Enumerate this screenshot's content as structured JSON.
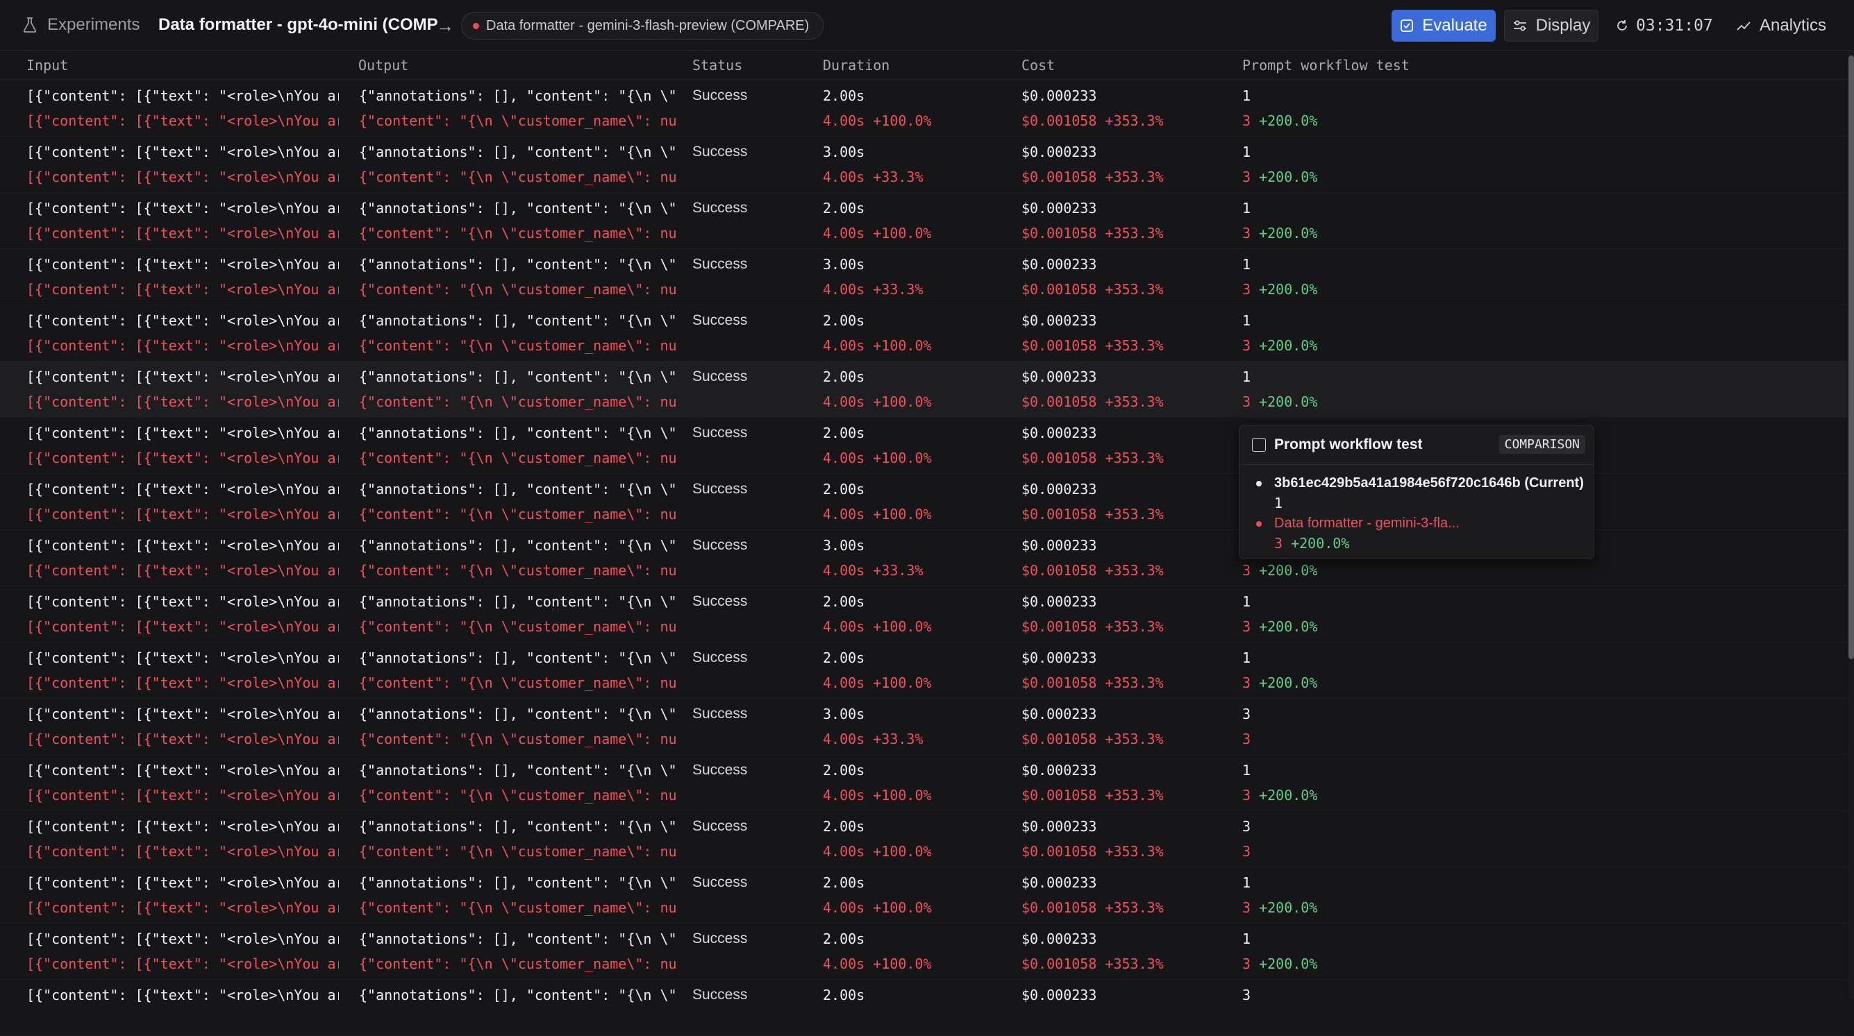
{
  "header": {
    "root_label": "Experiments",
    "title": "Data formatter - gpt-4o-mini (COMP",
    "compare_label": "Data formatter - gemini-3-flash-preview (COMPARE)",
    "evaluate_label": "Evaluate",
    "display_label": "Display",
    "timer": "03:31:07",
    "analytics_label": "Analytics"
  },
  "columns": [
    "Input",
    "Output",
    "Status",
    "Duration",
    "Cost",
    "Prompt workflow test"
  ],
  "rows": [
    {
      "input": "[{\"content\": [{\"text\": \"<role>\\nYou are a",
      "input_cmp": "[{\"content\": [{\"text\": \"<role>\\nYou are a",
      "output": "{\"annotations\": [], \"content\": \"{\\n \\\"cust",
      "output_cmp": "{\"content\": \"{\\n \\\"customer_name\\\": null,\\",
      "status": "Success",
      "duration": "2.00s",
      "duration_cmp": "4.00s +100.0%",
      "cost": "$0.000233",
      "cost_cmp": "$0.001058 +353.3%",
      "score": "1",
      "score_cmp": "3",
      "score_delta": "+200.0%"
    },
    {
      "input": "[{\"content\": [{\"text\": \"<role>\\nYou are a",
      "input_cmp": "[{\"content\": [{\"text\": \"<role>\\nYou are a",
      "output": "{\"annotations\": [], \"content\": \"{\\n \\\"cust",
      "output_cmp": "{\"content\": \"{\\n \\\"customer_name\\\": null,\\",
      "status": "Success",
      "duration": "3.00s",
      "duration_cmp": "4.00s +33.3%",
      "cost": "$0.000233",
      "cost_cmp": "$0.001058 +353.3%",
      "score": "1",
      "score_cmp": "3",
      "score_delta": "+200.0%"
    },
    {
      "input": "[{\"content\": [{\"text\": \"<role>\\nYou are a",
      "input_cmp": "[{\"content\": [{\"text\": \"<role>\\nYou are a",
      "output": "{\"annotations\": [], \"content\": \"{\\n \\\"cust",
      "output_cmp": "{\"content\": \"{\\n \\\"customer_name\\\": null,\\",
      "status": "Success",
      "duration": "2.00s",
      "duration_cmp": "4.00s +100.0%",
      "cost": "$0.000233",
      "cost_cmp": "$0.001058 +353.3%",
      "score": "1",
      "score_cmp": "3",
      "score_delta": "+200.0%"
    },
    {
      "input": "[{\"content\": [{\"text\": \"<role>\\nYou are a",
      "input_cmp": "[{\"content\": [{\"text\": \"<role>\\nYou are a",
      "output": "{\"annotations\": [], \"content\": \"{\\n \\\"cust",
      "output_cmp": "{\"content\": \"{\\n \\\"customer_name\\\": null,\\",
      "status": "Success",
      "duration": "3.00s",
      "duration_cmp": "4.00s +33.3%",
      "cost": "$0.000233",
      "cost_cmp": "$0.001058 +353.3%",
      "score": "1",
      "score_cmp": "3",
      "score_delta": "+200.0%"
    },
    {
      "input": "[{\"content\": [{\"text\": \"<role>\\nYou are a",
      "input_cmp": "[{\"content\": [{\"text\": \"<role>\\nYou are a",
      "output": "{\"annotations\": [], \"content\": \"{\\n \\\"cust",
      "output_cmp": "{\"content\": \"{\\n \\\"customer_name\\\": null,\\",
      "status": "Success",
      "duration": "2.00s",
      "duration_cmp": "4.00s +100.0%",
      "cost": "$0.000233",
      "cost_cmp": "$0.001058 +353.3%",
      "score": "1",
      "score_cmp": "3",
      "score_delta": "+200.0%"
    },
    {
      "input": "[{\"content\": [{\"text\": \"<role>\\nYou are a",
      "input_cmp": "[{\"content\": [{\"text\": \"<role>\\nYou are a",
      "output": "{\"annotations\": [], \"content\": \"{\\n \\\"cust",
      "output_cmp": "{\"content\": \"{\\n \\\"customer_name\\\": null,\\",
      "status": "Success",
      "duration": "2.00s",
      "duration_cmp": "4.00s +100.0%",
      "cost": "$0.000233",
      "cost_cmp": "$0.001058 +353.3%",
      "score": "1",
      "score_cmp": "3",
      "score_delta": "+200.0%"
    },
    {
      "input": "[{\"content\": [{\"text\": \"<role>\\nYou are a",
      "input_cmp": "[{\"content\": [{\"text\": \"<role>\\nYou are a",
      "output": "{\"annotations\": [], \"content\": \"{\\n \\\"cust",
      "output_cmp": "{\"content\": \"{\\n \\\"customer_name\\\": null,\\",
      "status": "Success",
      "duration": "2.00s",
      "duration_cmp": "4.00s +100.0%",
      "cost": "$0.000233",
      "cost_cmp": "$0.001058 +353.3%",
      "score": "",
      "score_cmp": "",
      "score_delta": ""
    },
    {
      "input": "[{\"content\": [{\"text\": \"<role>\\nYou are a",
      "input_cmp": "[{\"content\": [{\"text\": \"<role>\\nYou are a",
      "output": "{\"annotations\": [], \"content\": \"{\\n \\\"cust",
      "output_cmp": "{\"content\": \"{\\n \\\"customer_name\\\": null,\\",
      "status": "Success",
      "duration": "2.00s",
      "duration_cmp": "4.00s +100.0%",
      "cost": "$0.000233",
      "cost_cmp": "$0.001058 +353.3%",
      "score": "",
      "score_cmp": "",
      "score_delta": ""
    },
    {
      "input": "[{\"content\": [{\"text\": \"<role>\\nYou are a",
      "input_cmp": "[{\"content\": [{\"text\": \"<role>\\nYou are a",
      "output": "{\"annotations\": [], \"content\": \"{\\n \\\"cust",
      "output_cmp": "{\"content\": \"{\\n \\\"customer_name\\\": null,\\",
      "status": "Success",
      "duration": "3.00s",
      "duration_cmp": "4.00s +33.3%",
      "cost": "$0.000233",
      "cost_cmp": "$0.001058 +353.3%",
      "score": "",
      "score_cmp": "3",
      "score_delta": "+200.0%"
    },
    {
      "input": "[{\"content\": [{\"text\": \"<role>\\nYou are a",
      "input_cmp": "[{\"content\": [{\"text\": \"<role>\\nYou are a",
      "output": "{\"annotations\": [], \"content\": \"{\\n \\\"cust",
      "output_cmp": "{\"content\": \"{\\n \\\"customer_name\\\": null,\\",
      "status": "Success",
      "duration": "2.00s",
      "duration_cmp": "4.00s +100.0%",
      "cost": "$0.000233",
      "cost_cmp": "$0.001058 +353.3%",
      "score": "1",
      "score_cmp": "3",
      "score_delta": "+200.0%"
    },
    {
      "input": "[{\"content\": [{\"text\": \"<role>\\nYou are a",
      "input_cmp": "[{\"content\": [{\"text\": \"<role>\\nYou are a",
      "output": "{\"annotations\": [], \"content\": \"{\\n \\\"cust",
      "output_cmp": "{\"content\": \"{\\n \\\"customer_name\\\": null,\\",
      "status": "Success",
      "duration": "2.00s",
      "duration_cmp": "4.00s +100.0%",
      "cost": "$0.000233",
      "cost_cmp": "$0.001058 +353.3%",
      "score": "1",
      "score_cmp": "3",
      "score_delta": "+200.0%"
    },
    {
      "input": "[{\"content\": [{\"text\": \"<role>\\nYou are a",
      "input_cmp": "[{\"content\": [{\"text\": \"<role>\\nYou are a",
      "output": "{\"annotations\": [], \"content\": \"{\\n \\\"cust",
      "output_cmp": "{\"content\": \"{\\n \\\"customer_name\\\": null,\\",
      "status": "Success",
      "duration": "3.00s",
      "duration_cmp": "4.00s +33.3%",
      "cost": "$0.000233",
      "cost_cmp": "$0.001058 +353.3%",
      "score": "3",
      "score_cmp": "3",
      "score_delta": ""
    },
    {
      "input": "[{\"content\": [{\"text\": \"<role>\\nYou are a",
      "input_cmp": "[{\"content\": [{\"text\": \"<role>\\nYou are a",
      "output": "{\"annotations\": [], \"content\": \"{\\n \\\"cust",
      "output_cmp": "{\"content\": \"{\\n \\\"customer_name\\\": null,\\",
      "status": "Success",
      "duration": "2.00s",
      "duration_cmp": "4.00s +100.0%",
      "cost": "$0.000233",
      "cost_cmp": "$0.001058 +353.3%",
      "score": "1",
      "score_cmp": "3",
      "score_delta": "+200.0%"
    },
    {
      "input": "[{\"content\": [{\"text\": \"<role>\\nYou are a",
      "input_cmp": "[{\"content\": [{\"text\": \"<role>\\nYou are a",
      "output": "{\"annotations\": [], \"content\": \"{\\n \\\"cust",
      "output_cmp": "{\"content\": \"{\\n \\\"customer_name\\\": null,\\",
      "status": "Success",
      "duration": "2.00s",
      "duration_cmp": "4.00s +100.0%",
      "cost": "$0.000233",
      "cost_cmp": "$0.001058 +353.3%",
      "score": "3",
      "score_cmp": "3",
      "score_delta": ""
    },
    {
      "input": "[{\"content\": [{\"text\": \"<role>\\nYou are a",
      "input_cmp": "[{\"content\": [{\"text\": \"<role>\\nYou are a",
      "output": "{\"annotations\": [], \"content\": \"{\\n \\\"cust",
      "output_cmp": "{\"content\": \"{\\n \\\"customer_name\\\": null,\\",
      "status": "Success",
      "duration": "2.00s",
      "duration_cmp": "4.00s +100.0%",
      "cost": "$0.000233",
      "cost_cmp": "$0.001058 +353.3%",
      "score": "1",
      "score_cmp": "3",
      "score_delta": "+200.0%"
    },
    {
      "input": "[{\"content\": [{\"text\": \"<role>\\nYou are a",
      "input_cmp": "[{\"content\": [{\"text\": \"<role>\\nYou are a",
      "output": "{\"annotations\": [], \"content\": \"{\\n \\\"cust",
      "output_cmp": "{\"content\": \"{\\n \\\"customer_name\\\": null,\\",
      "status": "Success",
      "duration": "2.00s",
      "duration_cmp": "4.00s +100.0%",
      "cost": "$0.000233",
      "cost_cmp": "$0.001058 +353.3%",
      "score": "1",
      "score_cmp": "3",
      "score_delta": "+200.0%"
    },
    {
      "input": "[{\"content\": [{\"text\": \"<role>\\nYou are a",
      "input_cmp": "",
      "output": "{\"annotations\": [], \"content\": \"{\\n \\\"cust",
      "output_cmp": "",
      "status": "Success",
      "duration": "2.00s",
      "duration_cmp": "",
      "cost": "$0.000233",
      "cost_cmp": "",
      "score": "3",
      "score_cmp": "",
      "score_delta": ""
    }
  ],
  "popover": {
    "title": "Prompt workflow test",
    "badge": "COMPARISON",
    "current_label": "3b61ec429b5a41a1984e56f720c1646b (Current)",
    "current_value": "1",
    "compare_label": "Data formatter - gemini-3-fla...",
    "compare_value": "3",
    "compare_delta": "+200.0%"
  },
  "colors": {
    "accent": "#3b6ad9",
    "negative": "#f0505e",
    "positive": "#5fcf86",
    "background": "#161618"
  }
}
